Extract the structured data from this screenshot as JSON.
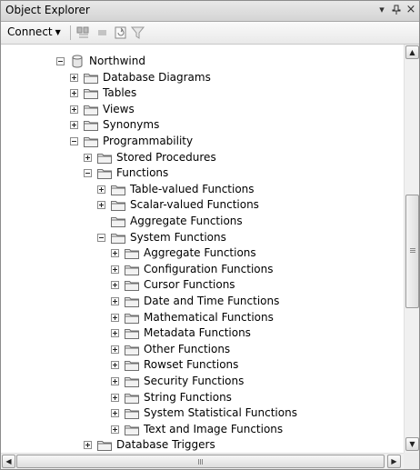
{
  "window": {
    "title": "Object Explorer",
    "pin_glyph": "▾",
    "autohide_glyph": "ꟷ",
    "close_glyph": "×"
  },
  "toolbar": {
    "connect_label": "Connect",
    "connect_caret": "▼"
  },
  "tree": {
    "items": [
      {
        "label": "Northwind",
        "level": 0,
        "expander": "minus",
        "icon": "database-icon"
      },
      {
        "label": "Database Diagrams",
        "level": 1,
        "expander": "plus",
        "icon": "folder-icon"
      },
      {
        "label": "Tables",
        "level": 1,
        "expander": "plus",
        "icon": "folder-icon"
      },
      {
        "label": "Views",
        "level": 1,
        "expander": "plus",
        "icon": "folder-icon"
      },
      {
        "label": "Synonyms",
        "level": 1,
        "expander": "plus",
        "icon": "folder-icon"
      },
      {
        "label": "Programmability",
        "level": 1,
        "expander": "minus",
        "icon": "folder-icon"
      },
      {
        "label": "Stored Procedures",
        "level": 2,
        "expander": "plus",
        "icon": "folder-icon"
      },
      {
        "label": "Functions",
        "level": 2,
        "expander": "minus",
        "icon": "folder-icon"
      },
      {
        "label": "Table-valued Functions",
        "level": 3,
        "expander": "plus",
        "icon": "folder-icon"
      },
      {
        "label": "Scalar-valued Functions",
        "level": 3,
        "expander": "plus",
        "icon": "folder-icon"
      },
      {
        "label": "Aggregate Functions",
        "level": 3,
        "expander": "none",
        "icon": "folder-icon"
      },
      {
        "label": "System Functions",
        "level": 3,
        "expander": "minus",
        "icon": "folder-icon"
      },
      {
        "label": "Aggregate Functions",
        "level": 4,
        "expander": "plus",
        "icon": "folder-icon"
      },
      {
        "label": "Configuration Functions",
        "level": 4,
        "expander": "plus",
        "icon": "folder-icon"
      },
      {
        "label": "Cursor Functions",
        "level": 4,
        "expander": "plus",
        "icon": "folder-icon"
      },
      {
        "label": "Date and Time Functions",
        "level": 4,
        "expander": "plus",
        "icon": "folder-icon"
      },
      {
        "label": "Mathematical Functions",
        "level": 4,
        "expander": "plus",
        "icon": "folder-icon"
      },
      {
        "label": "Metadata Functions",
        "level": 4,
        "expander": "plus",
        "icon": "folder-icon"
      },
      {
        "label": "Other Functions",
        "level": 4,
        "expander": "plus",
        "icon": "folder-icon"
      },
      {
        "label": "Rowset Functions",
        "level": 4,
        "expander": "plus",
        "icon": "folder-icon"
      },
      {
        "label": "Security Functions",
        "level": 4,
        "expander": "plus",
        "icon": "folder-icon"
      },
      {
        "label": "String Functions",
        "level": 4,
        "expander": "plus",
        "icon": "folder-icon"
      },
      {
        "label": "System Statistical Functions",
        "level": 4,
        "expander": "plus",
        "icon": "folder-icon"
      },
      {
        "label": "Text and Image Functions",
        "level": 4,
        "expander": "plus",
        "icon": "folder-icon"
      },
      {
        "label": "Database Triggers",
        "level": 2,
        "expander": "plus",
        "icon": "folder-icon"
      }
    ]
  },
  "scrollbar": {
    "up_glyph": "▲",
    "down_glyph": "▼",
    "left_glyph": "◀",
    "right_glyph": "▶"
  },
  "colors": {
    "folder_fill": "#f2f2f2",
    "folder_stroke": "#6e6e6e",
    "title_bg": "#dcdcdc"
  }
}
